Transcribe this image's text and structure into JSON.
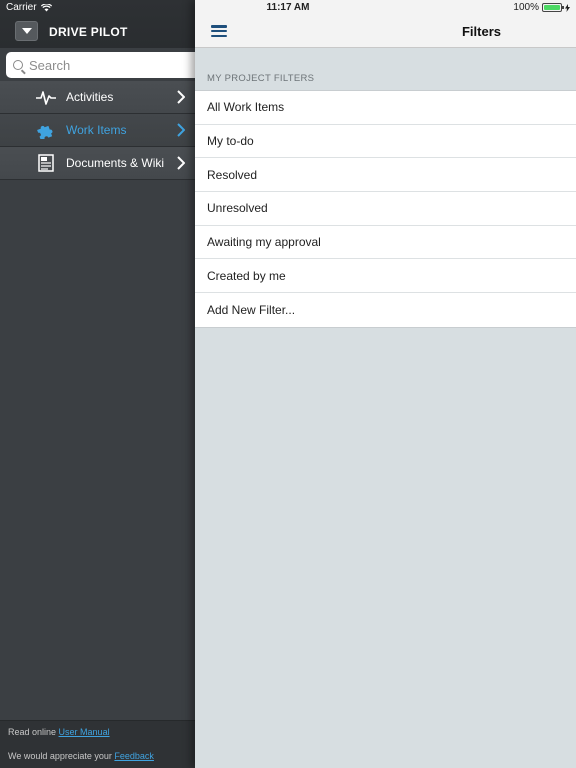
{
  "status_bar": {
    "carrier": "Carrier",
    "time": "11:17 AM",
    "battery": "100%",
    "battery_color": "#4cd964"
  },
  "sidebar": {
    "app_title": "DRIVE PILOT",
    "search_placeholder": "Search",
    "items": [
      {
        "label": "Activities",
        "icon": "activity-pulse-icon",
        "active": false
      },
      {
        "label": "Work Items",
        "icon": "puzzle-piece-icon",
        "active": true
      },
      {
        "label": "Documents & Wiki",
        "icon": "document-icon",
        "active": false
      }
    ],
    "footer": {
      "read_prefix": "Read online ",
      "manual_link": "User Manual",
      "feedback_prefix": "We would appreciate your ",
      "feedback_link": "Feedback"
    },
    "accent_color": "#3fa3e0"
  },
  "main": {
    "title": "Filters",
    "section_label": "MY PROJECT FILTERS",
    "filters": [
      "All Work Items",
      "My to-do",
      "Resolved",
      "Unresolved",
      "Awaiting my approval",
      "Created by me",
      "Add New Filter..."
    ]
  }
}
